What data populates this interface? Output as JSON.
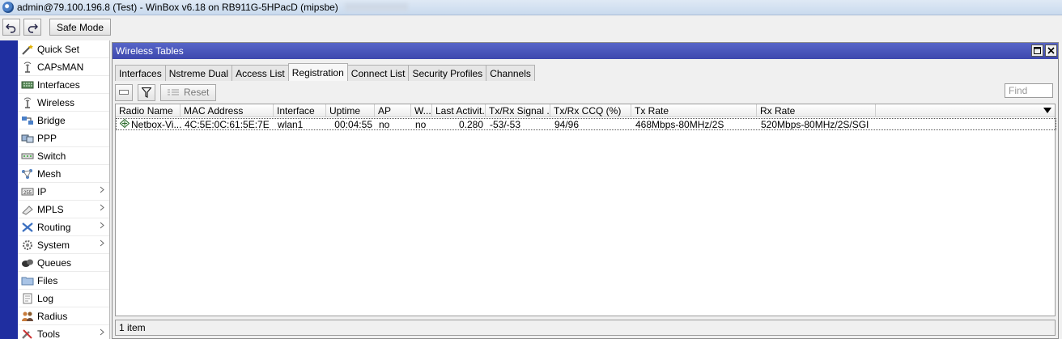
{
  "titlebar": {
    "title": "admin@79.100.196.8 (Test) - WinBox v6.18 on RB911G-5HPacD (mipsbe)"
  },
  "toolbar": {
    "safe_mode_label": "Safe Mode"
  },
  "sidebar": {
    "items": [
      {
        "label": "Quick Set",
        "icon": "wand-icon",
        "submenu": false
      },
      {
        "label": "CAPsMAN",
        "icon": "antenna-icon",
        "submenu": false
      },
      {
        "label": "Interfaces",
        "icon": "interfaces-icon",
        "submenu": false
      },
      {
        "label": "Wireless",
        "icon": "antenna-icon",
        "submenu": false
      },
      {
        "label": "Bridge",
        "icon": "bridge-icon",
        "submenu": false
      },
      {
        "label": "PPP",
        "icon": "ppp-icon",
        "submenu": false
      },
      {
        "label": "Switch",
        "icon": "switch-icon",
        "submenu": false
      },
      {
        "label": "Mesh",
        "icon": "mesh-icon",
        "submenu": false
      },
      {
        "label": "IP",
        "icon": "ip-icon",
        "submenu": true
      },
      {
        "label": "MPLS",
        "icon": "mpls-icon",
        "submenu": true
      },
      {
        "label": "Routing",
        "icon": "routing-icon",
        "submenu": true
      },
      {
        "label": "System",
        "icon": "gear-icon",
        "submenu": true
      },
      {
        "label": "Queues",
        "icon": "queues-icon",
        "submenu": false
      },
      {
        "label": "Files",
        "icon": "folder-icon",
        "submenu": false
      },
      {
        "label": "Log",
        "icon": "log-icon",
        "submenu": false
      },
      {
        "label": "Radius",
        "icon": "users-icon",
        "submenu": false
      },
      {
        "label": "Tools",
        "icon": "tools-icon",
        "submenu": true
      }
    ]
  },
  "window": {
    "title": "Wireless Tables",
    "tabs": [
      {
        "label": "Interfaces",
        "active": false
      },
      {
        "label": "Nstreme Dual",
        "active": false
      },
      {
        "label": "Access List",
        "active": false
      },
      {
        "label": "Registration",
        "active": true
      },
      {
        "label": "Connect List",
        "active": false
      },
      {
        "label": "Security Profiles",
        "active": false
      },
      {
        "label": "Channels",
        "active": false
      }
    ],
    "actions": {
      "reset_label": "Reset",
      "find_placeholder": "Find"
    },
    "table": {
      "columns": [
        "Radio Name",
        "MAC Address",
        "Interface",
        "Uptime",
        "AP",
        "W...",
        "Last Activit...",
        "Tx/Rx Signal ...",
        "Tx/Rx CCQ (%)",
        "Tx Rate",
        "Rx Rate"
      ],
      "sort_indicator": "/",
      "rows": [
        {
          "radio_name": "Netbox-Vi...",
          "mac": "4C:5E:0C:61:5E:7E",
          "interface": "wlan1",
          "uptime": "00:04:55",
          "ap": "no",
          "w": "no",
          "last_activity": "0.280",
          "signal": "-53/-53",
          "ccq": "94/96",
          "tx_rate": "468Mbps-80MHz/2S",
          "rx_rate": "520Mbps-80MHz/2S/SGI"
        }
      ]
    },
    "status": "1 item"
  }
}
